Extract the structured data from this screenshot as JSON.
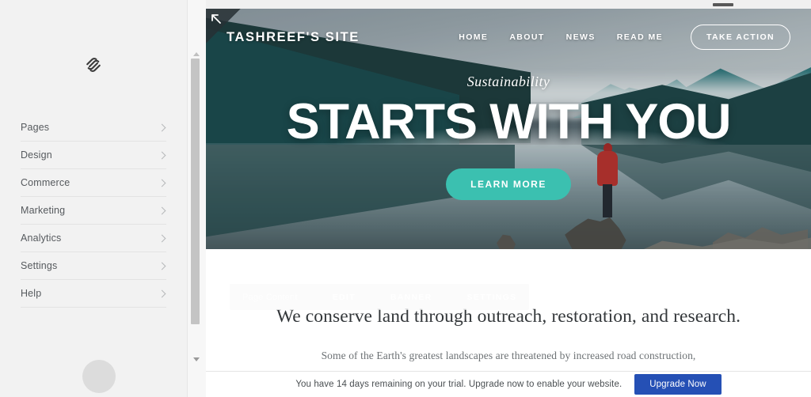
{
  "sidebar": {
    "logo_icon": "squarespace-logo-icon",
    "items": [
      {
        "label": "Pages",
        "icon": "chevron-right-icon"
      },
      {
        "label": "Design",
        "icon": "chevron-right-icon"
      },
      {
        "label": "Commerce",
        "icon": "chevron-right-icon"
      },
      {
        "label": "Marketing",
        "icon": "chevron-right-icon"
      },
      {
        "label": "Analytics",
        "icon": "chevron-right-icon"
      },
      {
        "label": "Settings",
        "icon": "chevron-right-icon"
      },
      {
        "label": "Help",
        "icon": "chevron-right-icon"
      }
    ]
  },
  "preview": {
    "corner_badge_icon": "arrow-up-left-icon",
    "site_title": "TASHREEF'S SITE",
    "nav": [
      {
        "label": "HOME"
      },
      {
        "label": "ABOUT"
      },
      {
        "label": "NEWS"
      },
      {
        "label": "READ ME"
      }
    ],
    "cta_label": "TAKE ACTION",
    "hero": {
      "eyebrow": "Sustainability",
      "title": "STARTS WITH YOU",
      "button_label": "LEARN MORE",
      "button_color": "#3bc0b0"
    },
    "toolbar": {
      "section_label": "Page Content",
      "edit_label": "EDIT",
      "banner_label": "BANNER",
      "settings_label": "SETTINGS"
    },
    "content": {
      "heading": "We conserve land through outreach, restoration, and research.",
      "paragraph": "Some of the Earth's greatest landscapes are threatened by increased road construction,"
    }
  },
  "trial": {
    "message": "You have 14 days remaining on your trial. Upgrade now to enable your website.",
    "button_label": "Upgrade Now",
    "button_color": "#2550b5"
  }
}
